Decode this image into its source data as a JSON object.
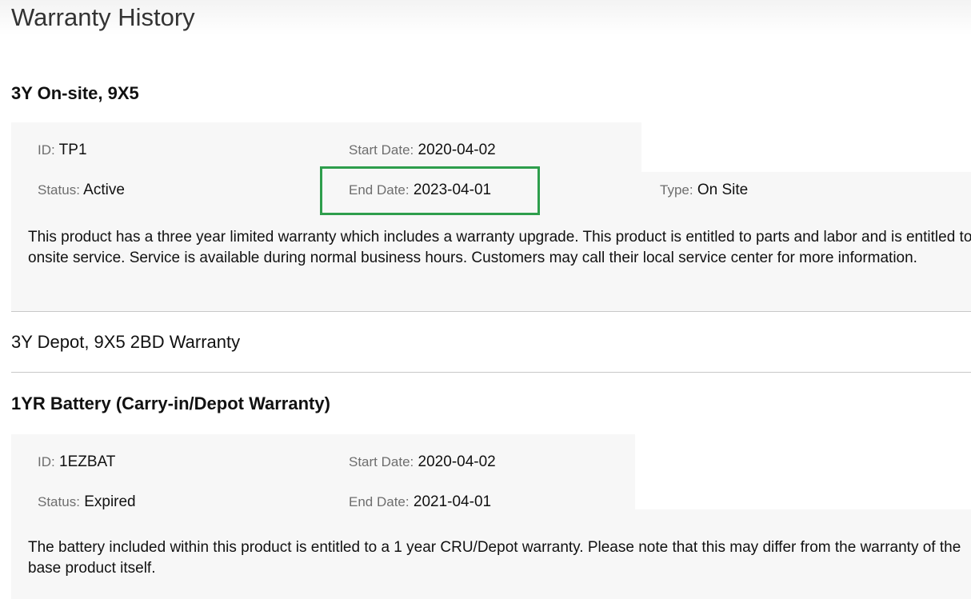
{
  "page": {
    "title": "Warranty History"
  },
  "colors": {
    "highlight": "#2e9e4c",
    "panel": "#f7f7f7",
    "label": "#6e6e6e"
  },
  "warranties": [
    {
      "name": "3Y On-site, 9X5",
      "fields": {
        "id_label": "ID:",
        "id_value": "TP1",
        "start_label": "Start Date:",
        "start_value": "2020-04-02",
        "status_label": "Status:",
        "status_value": "Active",
        "end_label": "End Date:",
        "end_value": "2023-04-01",
        "type_label": "Type:",
        "type_value": "On Site"
      },
      "description": "This product has a three year limited warranty which includes a warranty upgrade. This product is entitled to parts and labor and is entitled to onsite service. Service is available during normal business hours. Customers may call their local service center for more information."
    },
    {
      "name": "3Y Depot, 9X5 2BD Warranty"
    },
    {
      "name": "1YR Battery (Carry-in/Depot Warranty)",
      "fields": {
        "id_label": "ID:",
        "id_value": "1EZBAT",
        "start_label": "Start Date:",
        "start_value": "2020-04-02",
        "status_label": "Status:",
        "status_value": "Expired",
        "end_label": "End Date:",
        "end_value": "2021-04-01"
      },
      "description": "The battery included within this product is entitled to a 1 year CRU/Depot warranty. Please note that this may differ from the warranty of the base product itself."
    }
  ]
}
